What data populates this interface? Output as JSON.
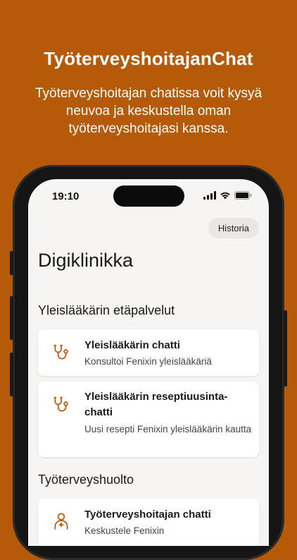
{
  "promo": {
    "title": "TyöterveyshoitajanChat",
    "subtitle": "Työterveyshoitajan chatissa voit kysyä neuvoa ja keskustella oman työterveyshoitajasi kanssa."
  },
  "status_bar": {
    "time": "19:10",
    "icons": [
      "signal-icon",
      "wifi-icon",
      "battery-icon"
    ]
  },
  "header": {
    "history_label": "Historia"
  },
  "page": {
    "title": "Digiklinikka"
  },
  "sections": [
    {
      "title": "Yleislääkärin etäpalvelut",
      "items": [
        {
          "icon": "stethoscope-icon",
          "title": "Yleislääkärin chatti",
          "description": "Konsultoi Fenixin yleislääkäriä"
        },
        {
          "icon": "stethoscope-icon",
          "title": "Yleislääkärin reseptiuusinta-chatti",
          "description": "Uusi resepti Fenixin yleislääkärin kautta"
        }
      ]
    },
    {
      "title": "Työterveyshuolto",
      "items": [
        {
          "icon": "nurse-icon",
          "title": "Työterveyshoitajan chatti",
          "description": "Keskustele Fenixin"
        }
      ]
    }
  ],
  "colors": {
    "background": "#B45A08",
    "accent": "#B45A08",
    "screen": "#F6F5F4"
  }
}
